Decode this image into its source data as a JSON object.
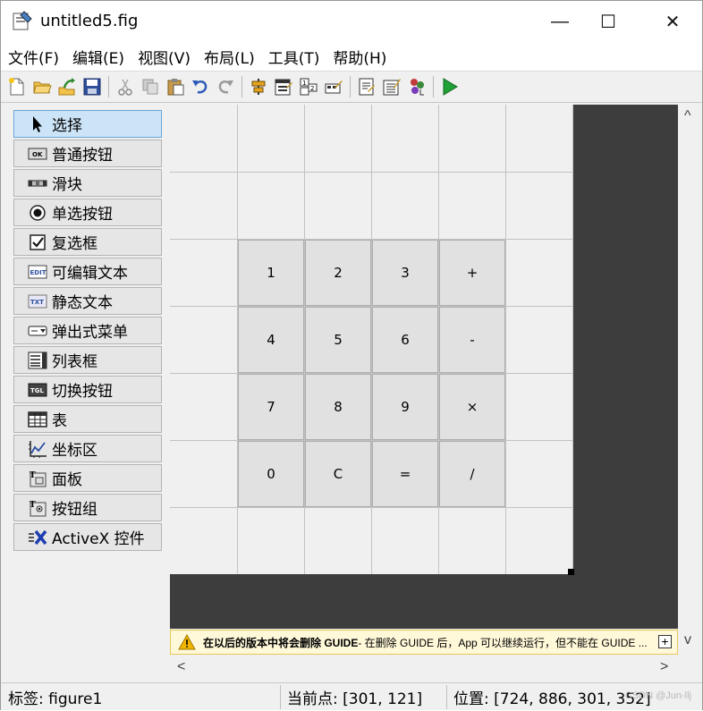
{
  "window": {
    "title": "untitled5.fig",
    "minimize": "—",
    "maximize": "☐",
    "close": "✕"
  },
  "menu": [
    "文件(F)",
    "编辑(E)",
    "视图(V)",
    "布局(L)",
    "工具(T)",
    "帮助(H)"
  ],
  "toolbar": {
    "groups": [
      [
        "new-file-icon",
        "open-folder-icon",
        "export-icon",
        "save-icon"
      ],
      [
        "cut-icon",
        "copy-icon",
        "paste-icon",
        "undo-icon",
        "redo-icon"
      ],
      [
        "align-objects-icon",
        "menu-editor-icon",
        "tab-order-icon",
        "toolbar-editor-icon"
      ],
      [
        "editor-icon",
        "property-inspector-icon",
        "object-browser-icon"
      ],
      [
        "run-icon"
      ]
    ]
  },
  "palette": [
    {
      "label": "选择",
      "icon": "pointer-icon",
      "selected": true
    },
    {
      "label": "普通按钮",
      "icon": "push-button-icon",
      "selected": false
    },
    {
      "label": "滑块",
      "icon": "slider-icon",
      "selected": false
    },
    {
      "label": "单选按钮",
      "icon": "radio-button-icon",
      "selected": false
    },
    {
      "label": "复选框",
      "icon": "checkbox-icon",
      "selected": false
    },
    {
      "label": "可编辑文本",
      "icon": "edit-text-icon",
      "selected": false
    },
    {
      "label": "静态文本",
      "icon": "static-text-icon",
      "selected": false
    },
    {
      "label": "弹出式菜单",
      "icon": "popup-menu-icon",
      "selected": false
    },
    {
      "label": "列表框",
      "icon": "listbox-icon",
      "selected": false
    },
    {
      "label": "切换按钮",
      "icon": "toggle-button-icon",
      "selected": false
    },
    {
      "label": "表",
      "icon": "table-icon",
      "selected": false
    },
    {
      "label": "坐标区",
      "icon": "axes-icon",
      "selected": false
    },
    {
      "label": "面板",
      "icon": "panel-icon",
      "selected": false
    },
    {
      "label": "按钮组",
      "icon": "button-group-icon",
      "selected": false
    },
    {
      "label": "ActiveX 控件",
      "icon": "activex-icon",
      "selected": false
    }
  ],
  "calculator": {
    "rows": [
      [
        "1",
        "2",
        "3",
        "+"
      ],
      [
        "4",
        "5",
        "6",
        "-"
      ],
      [
        "7",
        "8",
        "9",
        "×"
      ],
      [
        "0",
        "C",
        "=",
        "/"
      ]
    ]
  },
  "warning": {
    "bold": "在以后的版本中将会删除 GUIDE",
    "text": " - 在删除 GUIDE 后，App 可以继续运行，但不能在 GUIDE ...",
    "expand": "+"
  },
  "scroll": {
    "up": "^",
    "down": "v",
    "left": "<",
    "right": ">"
  },
  "status": {
    "tag": "标签: figure1",
    "current_point": "当前点:  [301, 121]",
    "position": "位置: [724, 886, 301, 352]",
    "watermark": "CSDN @Jun-llj"
  }
}
